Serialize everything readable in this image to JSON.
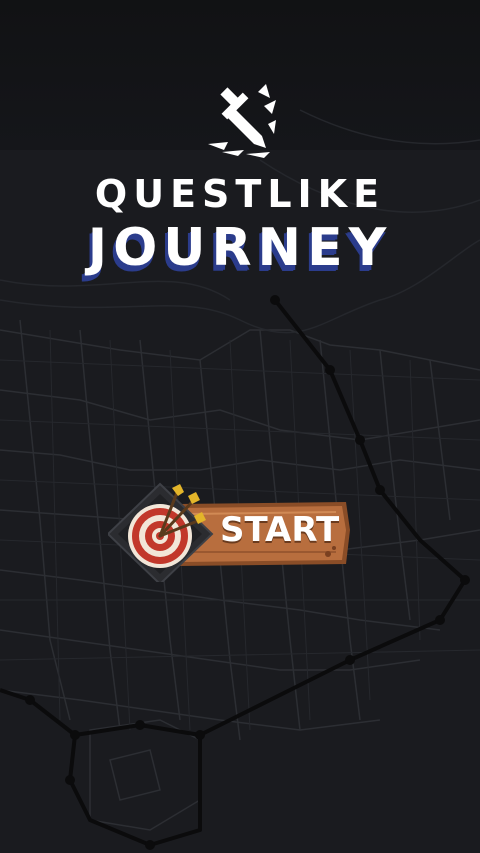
{
  "app": {
    "title_line1": "QUESTLIKE",
    "title_line2": "JOURNEY"
  },
  "start_button": {
    "label": "START",
    "icon": "target-icon"
  },
  "colors": {
    "background": "#1a1b1f",
    "map_lines": "#2c2e33",
    "route": "#0b0b0c",
    "wood": "#b86e3e",
    "title_shadow": "#2b3c8c",
    "target_red": "#c2382b",
    "arrow_gold": "#e3b52a"
  }
}
